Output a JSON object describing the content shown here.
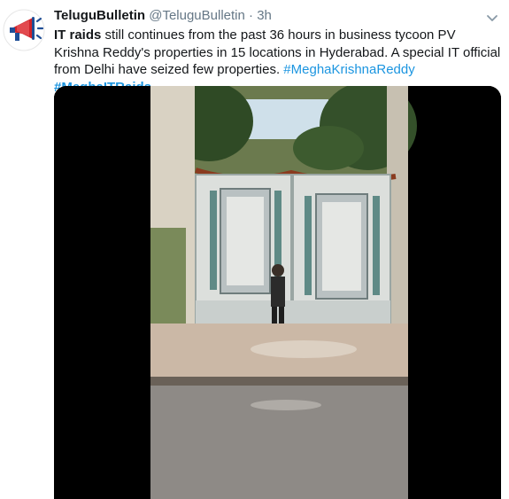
{
  "tweet": {
    "display_name": "TeluguBulletin",
    "handle": "@TeluguBulletin",
    "separator": "·",
    "time": "3h",
    "text": {
      "bold_lead": "IT raids",
      "rest": " still continues from the past 36 hours in business tycoon PV Krishna Reddy's properties in 15 locations in Hyderabad. A special IT official from Delhi have seized few properties. ",
      "hashtag1": "#MeghaKrishnaReddy",
      "hashtag2": "#MeghaITRaids"
    },
    "avatar_icon": "megaphone-icon",
    "menu_icon": "chevron-down-icon"
  },
  "colors": {
    "link": "#1b95e0",
    "muted": "#657786",
    "avatar_accent": "#d0232a",
    "avatar_blue": "#1f4e96"
  }
}
